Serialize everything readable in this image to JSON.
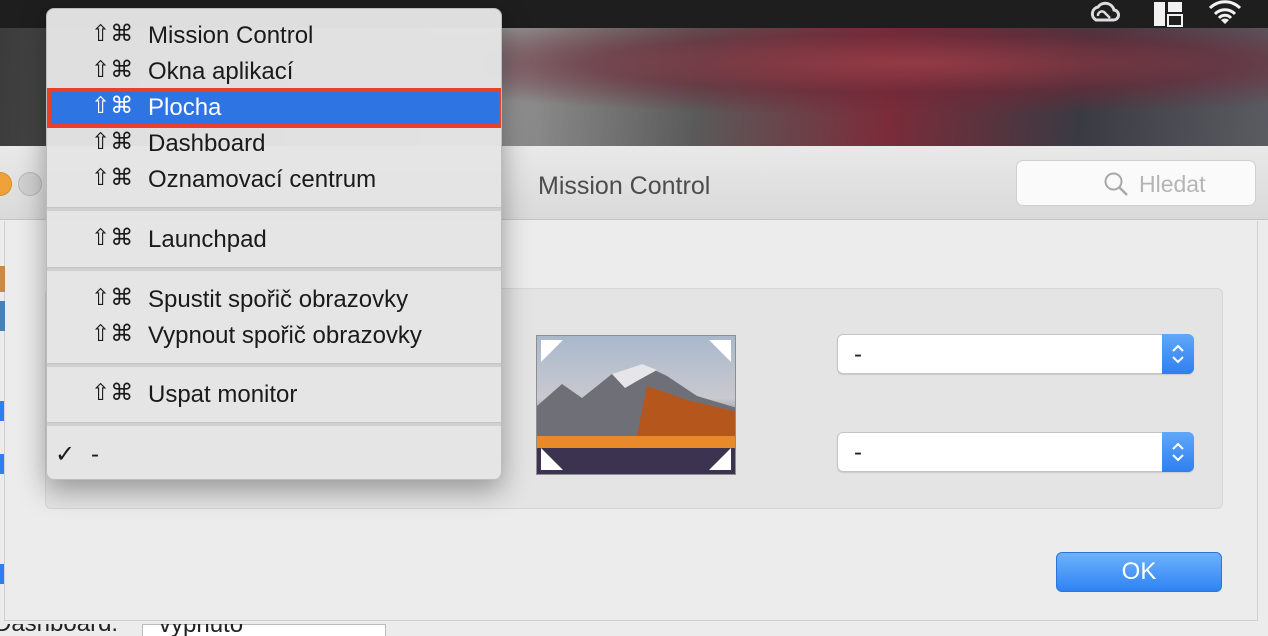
{
  "menubar": {
    "icons": [
      "creative-cloud-icon",
      "window-layout-icon",
      "wifi-icon"
    ]
  },
  "window": {
    "title": "Mission Control",
    "search_placeholder": "Hledat"
  },
  "hot_corners": {
    "top_right_value": "-",
    "bottom_right_value": "-"
  },
  "ok_button": "OK",
  "background_fragment": {
    "label": "Dashboard:",
    "select_value": "vypnuto"
  },
  "menu": {
    "modifiers": "⇧⌘",
    "groups": [
      [
        "Mission Control",
        "Okna aplikací",
        "Plocha",
        "Dashboard",
        "Oznamovací centrum"
      ],
      [
        "Launchpad"
      ],
      [
        "Spustit spořič obrazovky",
        "Vypnout spořič obrazovky"
      ],
      [
        "Uspat monitor"
      ]
    ],
    "selected_item": "Plocha",
    "checked_item": "-",
    "check_mark": "✓"
  },
  "colors": {
    "selection_blue": "#2f74e3",
    "highlight_red": "#e8402a",
    "button_blue": "#3b8cf5"
  }
}
